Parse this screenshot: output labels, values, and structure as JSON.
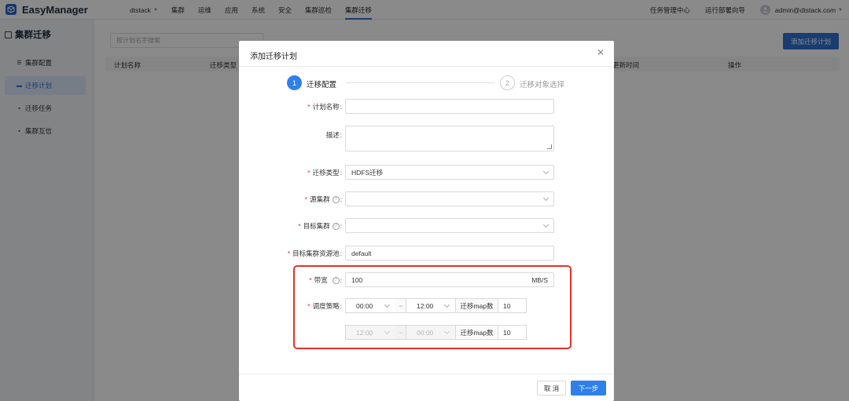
{
  "app": {
    "name": "EasyManager",
    "logo_icon": "cube-logo-icon"
  },
  "nav": {
    "items": [
      {
        "label": "dtstack",
        "has_dropdown": true
      },
      {
        "label": "集群"
      },
      {
        "label": "运维"
      },
      {
        "label": "应用"
      },
      {
        "label": "系统"
      },
      {
        "label": "安全"
      },
      {
        "label": "集群巡检"
      },
      {
        "label": "集群迁移",
        "active": true
      }
    ],
    "right_links": [
      "任务管理中心",
      "运行部署向导"
    ],
    "user": "admin@dtstack.com"
  },
  "sidebar": {
    "title": "集群迁移",
    "items": [
      {
        "label": "集群配置",
        "icon": "sliders-icon"
      },
      {
        "label": "迁移计划",
        "icon": "list-icon",
        "active": true
      },
      {
        "label": "迁移任务",
        "icon": "task-icon"
      },
      {
        "label": "集群互信",
        "icon": "trust-icon"
      }
    ]
  },
  "main": {
    "search_placeholder": "按计划名字搜索",
    "add_button": "添加迁移计划",
    "columns": [
      "计划名称",
      "迁移类型",
      "更新时间",
      "操作"
    ]
  },
  "modal": {
    "title": "添加迁移计划",
    "steps": [
      {
        "num": "1",
        "label": "迁移配置",
        "active": true
      },
      {
        "num": "2",
        "label": "迁移对象选择",
        "active": false
      }
    ],
    "form": {
      "plan_name": {
        "label": "计划名称",
        "required": true,
        "value": ""
      },
      "description": {
        "label": "描述",
        "required": false,
        "value": ""
      },
      "migration_type": {
        "label": "迁移类型",
        "required": true,
        "value": "HDFS迁移"
      },
      "source_cluster": {
        "label": "源集群",
        "required": true,
        "value": ""
      },
      "target_cluster": {
        "label": "目标集群",
        "required": true,
        "value": ""
      },
      "target_pool": {
        "label": "目标集群资源池",
        "required": true,
        "value": "default"
      },
      "bandwidth": {
        "label": "带宽",
        "required": true,
        "value": "100",
        "unit": "MB/S"
      },
      "schedule": {
        "label": "调度策略",
        "required": true,
        "rows": [
          {
            "start": "00:00",
            "end": "12:00",
            "map_label": "迁移map数",
            "map_value": "10",
            "disabled": false
          },
          {
            "start": "12:00",
            "end": "00:00",
            "map_label": "迁移map数",
            "map_value": "10",
            "disabled": true
          }
        ],
        "separator": "~"
      }
    },
    "footer": {
      "cancel": "取 消",
      "next": "下一步"
    }
  },
  "colors": {
    "primary": "#2f80ed",
    "highlight_box": "#e3322a",
    "required": "#f5222d"
  }
}
